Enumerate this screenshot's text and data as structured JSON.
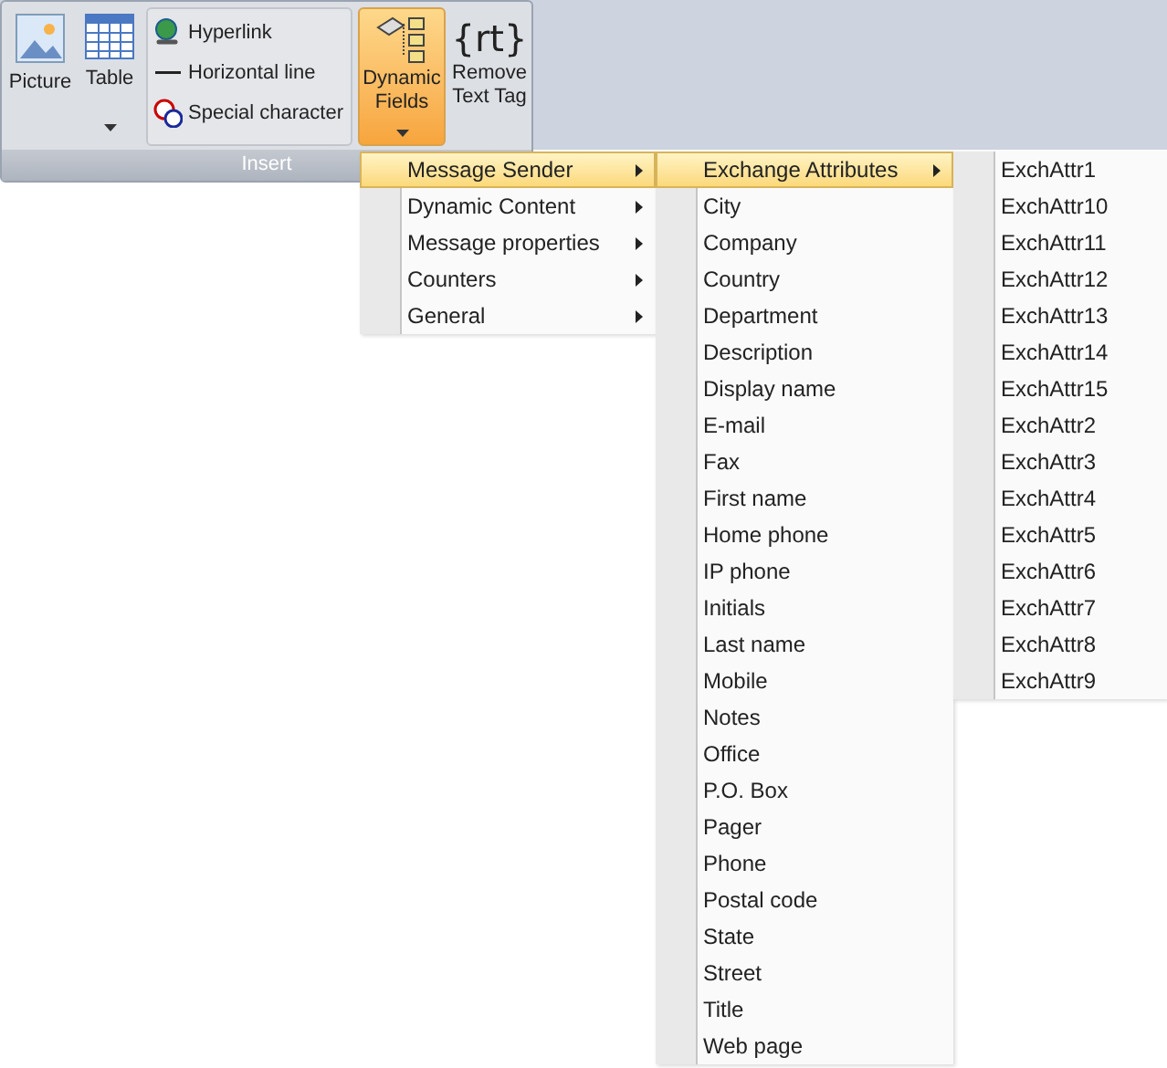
{
  "ribbon": {
    "group_label": "Insert",
    "large_buttons": [
      {
        "kind": "picture",
        "label": "Picture",
        "dropdown": false,
        "selected": false
      },
      {
        "kind": "table",
        "label": "Table",
        "dropdown": true,
        "selected": false
      }
    ],
    "small_buttons": [
      {
        "kind": "hyperlink",
        "label": "Hyperlink"
      },
      {
        "kind": "line",
        "label": "Horizontal line"
      },
      {
        "kind": "special",
        "label": "Special character"
      }
    ],
    "split_button": {
      "label_lines": [
        "Dynamic",
        "Fields"
      ],
      "selected": true
    },
    "tag_button": {
      "glyph": "{rt}",
      "label_lines": [
        "Remove",
        "Text Tag"
      ]
    }
  },
  "menus": [
    {
      "items": [
        {
          "label": "Message Sender",
          "has_submenu": true,
          "selected": true
        },
        {
          "label": "Dynamic Content",
          "has_submenu": true,
          "selected": false
        },
        {
          "label": "Message properties",
          "has_submenu": true,
          "selected": false
        },
        {
          "label": "Counters",
          "has_submenu": true,
          "selected": false
        },
        {
          "label": "General",
          "has_submenu": true,
          "selected": false
        }
      ]
    },
    {
      "items": [
        {
          "label": "Exchange Attributes",
          "has_submenu": true,
          "selected": true
        },
        {
          "label": "City",
          "has_submenu": false,
          "selected": false
        },
        {
          "label": "Company",
          "has_submenu": false,
          "selected": false
        },
        {
          "label": "Country",
          "has_submenu": false,
          "selected": false
        },
        {
          "label": "Department",
          "has_submenu": false,
          "selected": false
        },
        {
          "label": "Description",
          "has_submenu": false,
          "selected": false
        },
        {
          "label": "Display name",
          "has_submenu": false,
          "selected": false
        },
        {
          "label": "E-mail",
          "has_submenu": false,
          "selected": false
        },
        {
          "label": "Fax",
          "has_submenu": false,
          "selected": false
        },
        {
          "label": "First name",
          "has_submenu": false,
          "selected": false
        },
        {
          "label": "Home phone",
          "has_submenu": false,
          "selected": false
        },
        {
          "label": "IP phone",
          "has_submenu": false,
          "selected": false
        },
        {
          "label": "Initials",
          "has_submenu": false,
          "selected": false
        },
        {
          "label": "Last name",
          "has_submenu": false,
          "selected": false
        },
        {
          "label": "Mobile",
          "has_submenu": false,
          "selected": false
        },
        {
          "label": "Notes",
          "has_submenu": false,
          "selected": false
        },
        {
          "label": "Office",
          "has_submenu": false,
          "selected": false
        },
        {
          "label": "P.O. Box",
          "has_submenu": false,
          "selected": false
        },
        {
          "label": "Pager",
          "has_submenu": false,
          "selected": false
        },
        {
          "label": "Phone",
          "has_submenu": false,
          "selected": false
        },
        {
          "label": "Postal code",
          "has_submenu": false,
          "selected": false
        },
        {
          "label": "State",
          "has_submenu": false,
          "selected": false
        },
        {
          "label": "Street",
          "has_submenu": false,
          "selected": false
        },
        {
          "label": "Title",
          "has_submenu": false,
          "selected": false
        },
        {
          "label": "Web page",
          "has_submenu": false,
          "selected": false
        }
      ]
    },
    {
      "items": [
        {
          "label": "ExchAttr1",
          "has_submenu": false,
          "selected": false
        },
        {
          "label": "ExchAttr10",
          "has_submenu": false,
          "selected": false
        },
        {
          "label": "ExchAttr11",
          "has_submenu": false,
          "selected": false
        },
        {
          "label": "ExchAttr12",
          "has_submenu": false,
          "selected": false
        },
        {
          "label": "ExchAttr13",
          "has_submenu": false,
          "selected": false
        },
        {
          "label": "ExchAttr14",
          "has_submenu": false,
          "selected": false
        },
        {
          "label": "ExchAttr15",
          "has_submenu": false,
          "selected": false
        },
        {
          "label": "ExchAttr2",
          "has_submenu": false,
          "selected": false
        },
        {
          "label": "ExchAttr3",
          "has_submenu": false,
          "selected": false
        },
        {
          "label": "ExchAttr4",
          "has_submenu": false,
          "selected": false
        },
        {
          "label": "ExchAttr5",
          "has_submenu": false,
          "selected": false
        },
        {
          "label": "ExchAttr6",
          "has_submenu": false,
          "selected": false
        },
        {
          "label": "ExchAttr7",
          "has_submenu": false,
          "selected": false
        },
        {
          "label": "ExchAttr8",
          "has_submenu": false,
          "selected": false
        },
        {
          "label": "ExchAttr9",
          "has_submenu": false,
          "selected": false
        }
      ]
    }
  ]
}
